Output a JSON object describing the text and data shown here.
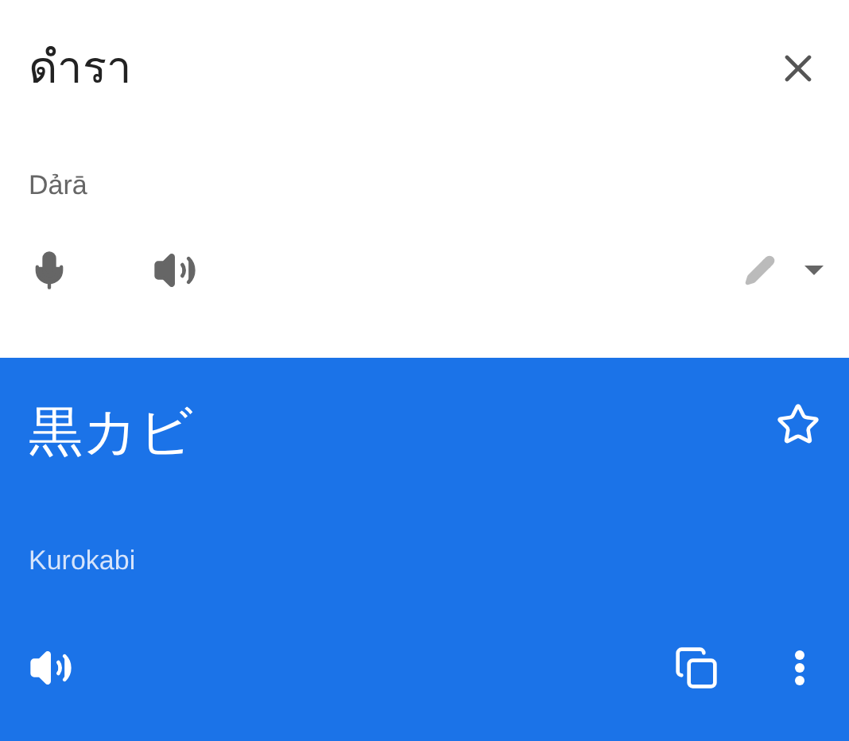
{
  "source": {
    "text": "ดำรา",
    "transliteration": "Dảrā"
  },
  "translation": {
    "text": "黒カビ",
    "transliteration": "Kurokabi",
    "starred": false
  }
}
